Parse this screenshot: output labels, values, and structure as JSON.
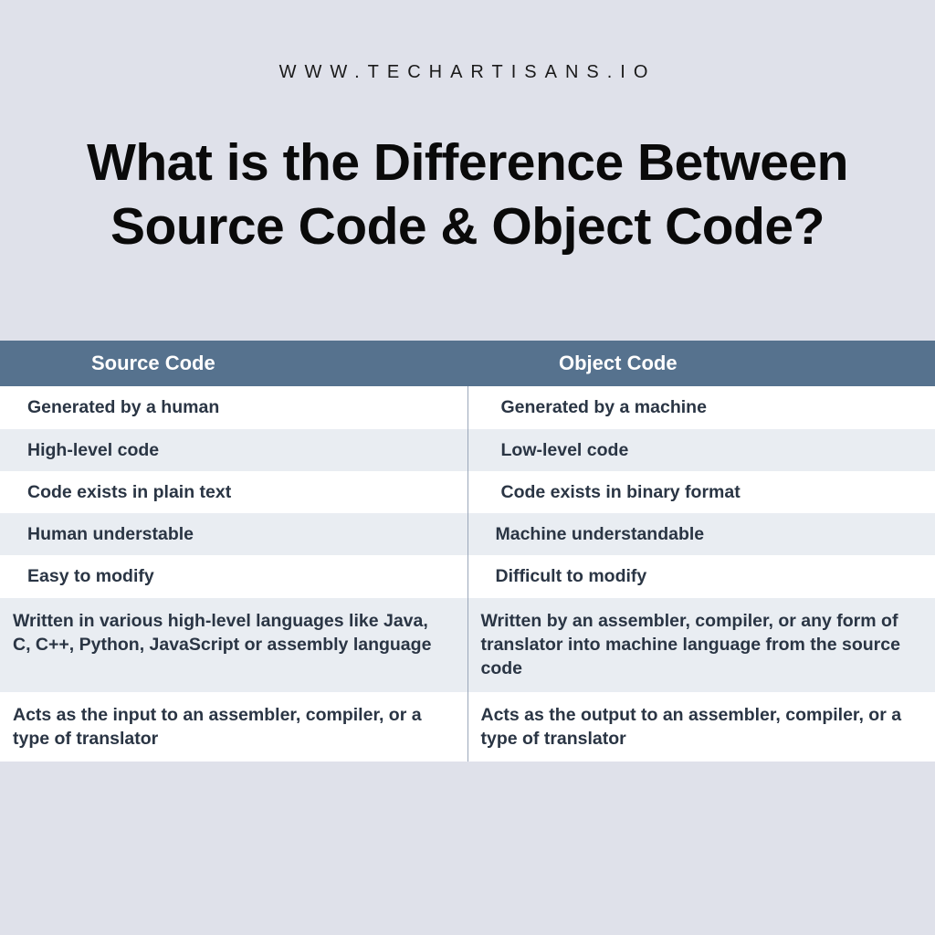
{
  "header": {
    "url": "WWW.TECHARTISANS.IO"
  },
  "title": "What is the Difference Between Source Code & Object Code?",
  "table": {
    "headers": {
      "left": "Source Code",
      "right": "Object Code"
    },
    "rows": [
      {
        "left": "Generated by a human",
        "right": "Generated by a machine"
      },
      {
        "left": "High-level code",
        "right": "Low-level code"
      },
      {
        "left": "Code exists in plain text",
        "right": "Code exists in binary format"
      },
      {
        "left": "Human understable",
        "right": "Machine understandable"
      },
      {
        "left": "Easy to modify",
        "right": "Difficult to modify"
      },
      {
        "left": "Written in various high-level languages like Java, C, C++, Python, JavaScript or assembly language",
        "right": "Written by an assembler, compiler, or any form of translator into machine language from the source code"
      },
      {
        "left": "Acts as the input to an assembler, compiler, or a type of translator",
        "right": "Acts as the output to an assembler, compiler, or a type of translator"
      }
    ]
  }
}
